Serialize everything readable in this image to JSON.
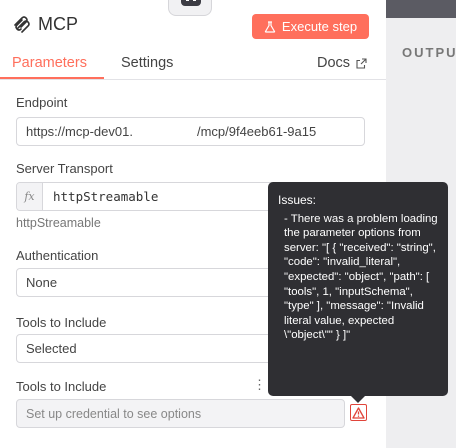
{
  "node": {
    "title": "MCP"
  },
  "toolbar": {
    "execute_label": "Execute step"
  },
  "tabs": [
    {
      "label": "Parameters",
      "active": true
    },
    {
      "label": "Settings",
      "active": false
    },
    {
      "label": "Docs",
      "active": false
    }
  ],
  "output": {
    "label": "OUTPU"
  },
  "fields": {
    "endpoint": {
      "label": "Endpoint",
      "value_start": "https://mcp-dev01.",
      "value_end": "/mcp/9f4eeb61-9a15"
    },
    "transport": {
      "label": "Server Transport",
      "value": "httpStreamable",
      "hint": "httpStreamable",
      "expr_icon": "fx"
    },
    "authentication": {
      "label": "Authentication",
      "value": "None"
    },
    "tools_mode": {
      "label": "Tools to Include",
      "value": "Selected"
    },
    "tools_list": {
      "label": "Tools to Include",
      "placeholder": "Set up credential to see options"
    }
  },
  "tooltip": {
    "title": "Issues:",
    "body": "- There was a problem loading the parameter options from server: \"[ { \"received\": \"string\", \"code\": \"invalid_literal\", \"expected\": \"object\", \"path\": [ \"tools\", 1, \"inputSchema\", \"type\" ], \"message\": \"Invalid literal value, expected \\\"object\\\"\" } ]\""
  },
  "colors": {
    "accent": "#ff6f5c",
    "warning": "#e0443a",
    "tooltip_bg": "#2f2f33"
  },
  "icons": {
    "logo": "mcp-logo-icon",
    "execute": "flask-icon",
    "docs": "external-link-icon",
    "menu": "kebab-menu-icon",
    "warning": "warning-triangle-icon"
  }
}
